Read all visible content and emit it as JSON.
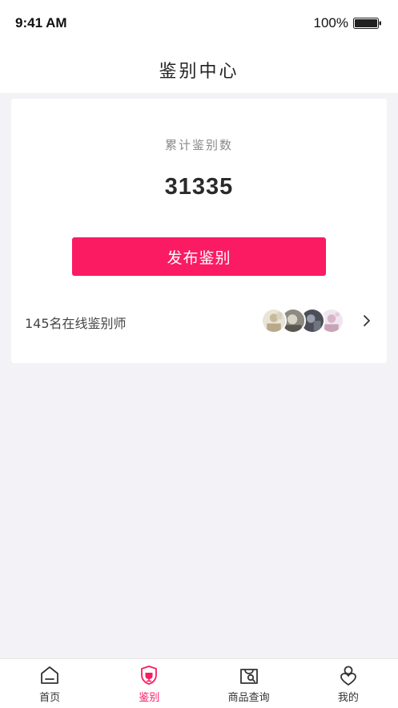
{
  "status_bar": {
    "time": "9:41 AM",
    "battery": "100%"
  },
  "nav": {
    "title": "鉴别中心"
  },
  "card": {
    "total_label": "累计鉴别数",
    "total_value": "31335",
    "publish_button": "发布鉴别",
    "online_text": "145名在线鉴别师"
  },
  "tabs": [
    {
      "label": "首页",
      "icon": "home-icon"
    },
    {
      "label": "鉴别",
      "icon": "shield-icon",
      "active": true
    },
    {
      "label": "商品查询",
      "icon": "bag-search-icon"
    },
    {
      "label": "我的",
      "icon": "user-heart-icon"
    }
  ],
  "colors": {
    "accent": "#fa1b63",
    "background": "#f3f2f7"
  }
}
